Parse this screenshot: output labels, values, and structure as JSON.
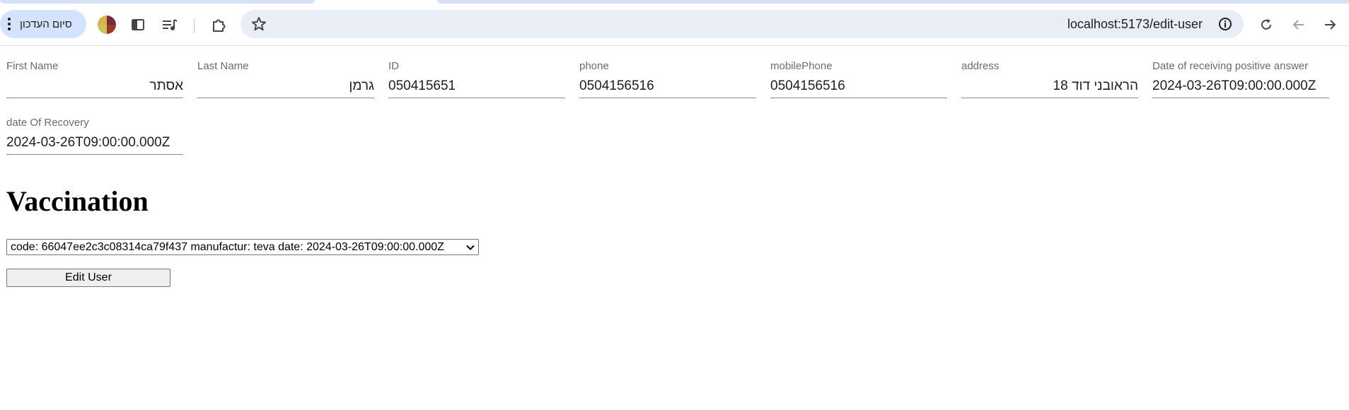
{
  "browser": {
    "update_button_label": "סיום העדכון",
    "url": "localhost:5173/edit-user",
    "icons": [
      "kebab-menu-icon",
      "profile-avatar",
      "side-panel-icon",
      "reading-list-icon",
      "extensions-icon",
      "bookmark-star-icon",
      "site-info-icon",
      "reload-icon",
      "back-icon",
      "forward-icon"
    ]
  },
  "form": {
    "fields": [
      {
        "label": "First Name",
        "value": "אסתר",
        "rtl": true
      },
      {
        "label": "Last Name",
        "value": "גרמן",
        "rtl": true
      },
      {
        "label": "ID",
        "value": "050415651",
        "rtl": false
      },
      {
        "label": "phone",
        "value": "0504156516",
        "rtl": false
      },
      {
        "label": "mobilePhone",
        "value": "0504156516",
        "rtl": false
      },
      {
        "label": "address",
        "value": "הראובני דוד 18",
        "rtl": true
      },
      {
        "label": "Date of receiving positive answer",
        "value": "2024-03-26T09:00:00.000Z",
        "rtl": false
      },
      {
        "label": "date Of Recovery",
        "value": "2024-03-26T09:00:00.000Z",
        "rtl": false
      }
    ]
  },
  "vaccination": {
    "heading": "Vaccination",
    "selected_option": "code: 66047ee2c3c08314ca79f437 manufactur: teva date: 2024-03-26T09:00:00.000Z"
  },
  "actions": {
    "edit_user_label": "Edit User"
  }
}
